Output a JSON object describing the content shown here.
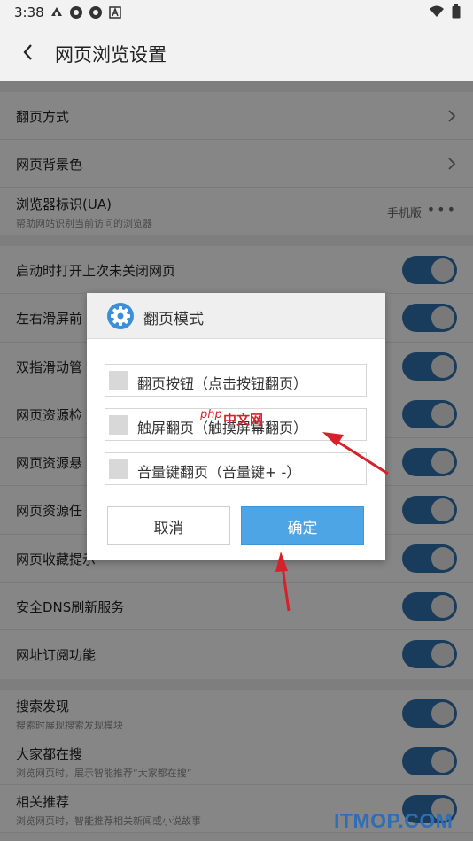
{
  "status_bar": {
    "time": "3:38"
  },
  "header": {
    "title": "网页浏览设置"
  },
  "settings": {
    "page_turn_mode": "翻页方式",
    "bg_color": "网页背景色",
    "ua_label": "浏览器标识(UA)",
    "ua_sub": "帮助网站识别当前访问的浏览器",
    "ua_value": "手机版",
    "ua_more": "•••",
    "toggles": [
      {
        "label": "启动时打开上次未关闭网页",
        "on": true
      },
      {
        "label": "左右滑屏前",
        "on": true
      },
      {
        "label": "双指滑动管",
        "on": true
      },
      {
        "label": "网页资源检",
        "on": true
      },
      {
        "label": "网页资源悬",
        "on": true
      },
      {
        "label": "网页资源任",
        "on": true
      },
      {
        "label": "网页收藏提示",
        "on": true
      },
      {
        "label": "安全DNS刷新服务",
        "on": true
      },
      {
        "label": "网址订阅功能",
        "on": true
      }
    ],
    "discovery": [
      {
        "label": "搜索发现",
        "sub": "搜索时展现搜索发现模块",
        "on": true
      },
      {
        "label": "大家都在搜",
        "sub": "浏览网页时，展示智能推荐“大家都在搜”",
        "on": true
      },
      {
        "label": "相关推荐",
        "sub": "浏览网页时，智能推荐相关新闻或小说故事",
        "on": true
      }
    ]
  },
  "dialog": {
    "title": "翻页模式",
    "options": [
      {
        "label": "翻页按钮（点击按钮翻页）",
        "checked": false
      },
      {
        "label": "触屏翻页（触摸屏幕翻页）",
        "checked": false
      },
      {
        "label": "音量键翻页（音量键+ -）",
        "checked": false
      }
    ],
    "cancel": "取消",
    "confirm": "确定"
  },
  "watermarks": {
    "php_logo": "php",
    "site": "中文网",
    "itmop": "ITMOP.COM"
  },
  "colors": {
    "toggle_on": "#2f6ea8",
    "confirm_button": "#4ea5e6",
    "annotation_arrow": "#d7212a"
  }
}
